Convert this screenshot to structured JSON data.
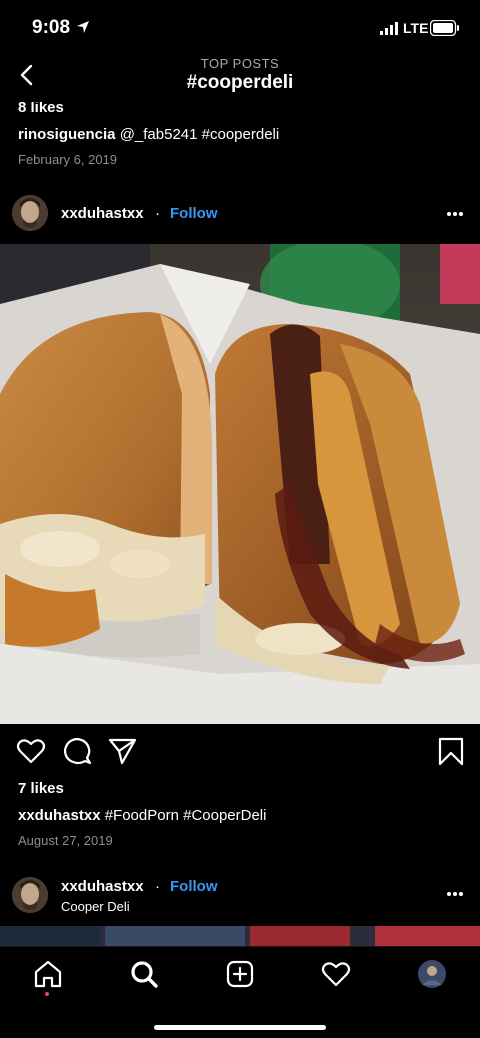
{
  "status_bar": {
    "time": "9:08",
    "network": "LTE"
  },
  "header": {
    "subtitle": "TOP POSTS",
    "title": "#cooperdeli"
  },
  "prev_post": {
    "likes": "8 likes",
    "caption_user": "rinosiguencia",
    "caption_text": " @_fab5241 #cooperdeli",
    "date": "February 6, 2019"
  },
  "post": {
    "username": "xxduhastxx",
    "separator": "·",
    "follow_label": "Follow",
    "likes": "7 likes",
    "caption_user": "xxduhastxx",
    "caption_text": " #FoodPorn #CooperDeli",
    "date": "August 27, 2019"
  },
  "next_post": {
    "username": "xxduhastxx",
    "separator": "·",
    "follow_label": "Follow",
    "location": "Cooper Deli"
  },
  "icons": {
    "back": "chevron-left-icon",
    "more": "more-horizontal-icon",
    "like": "heart-icon",
    "comment": "comment-icon",
    "share": "send-icon",
    "save": "bookmark-icon",
    "home": "home-icon",
    "search": "search-icon",
    "new_post": "plus-square-icon",
    "activity": "heart-icon",
    "profile": "avatar"
  },
  "colors": {
    "accent": "#3897f0",
    "background": "#000000",
    "secondary_text": "#8e8e8e",
    "notification": "#ed4956"
  }
}
